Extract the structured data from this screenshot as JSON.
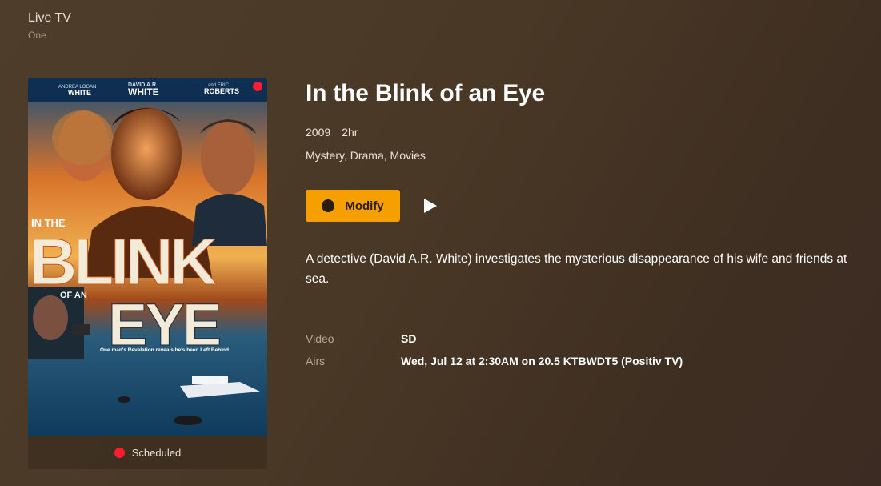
{
  "header": {
    "title": "Live TV",
    "subtitle": "One"
  },
  "poster": {
    "cast_left_first": "ANDREA LOGAN",
    "cast_left_last": "WHITE",
    "cast_mid_first": "DAVID A.R.",
    "cast_mid_last": "WHITE",
    "cast_right_first": "and ERIC",
    "cast_right_last": "ROBERTS",
    "title_line1": "IN THE",
    "title_line2": "BLINK",
    "title_line3": "OF AN",
    "title_line4": "EYE",
    "tagline": "One man's Revelation reveals he's been Left Behind.",
    "status": "Scheduled"
  },
  "program": {
    "title": "In the Blink of an Eye",
    "year": "2009",
    "duration": "2hr",
    "genres": "Mystery, Drama, Movies",
    "description": "A detective (David A.R. White) investigates the mysterious disappearance of his wife and friends at sea."
  },
  "actions": {
    "modify_label": "Modify"
  },
  "details": [
    {
      "label": "Video",
      "value": "SD"
    },
    {
      "label": "Airs",
      "value": "Wed, Jul 12 at 2:30AM on 20.5 KTBWDT5 (Positiv TV)"
    }
  ],
  "colors": {
    "accent": "#f5a000",
    "record": "#ff1d2d"
  }
}
